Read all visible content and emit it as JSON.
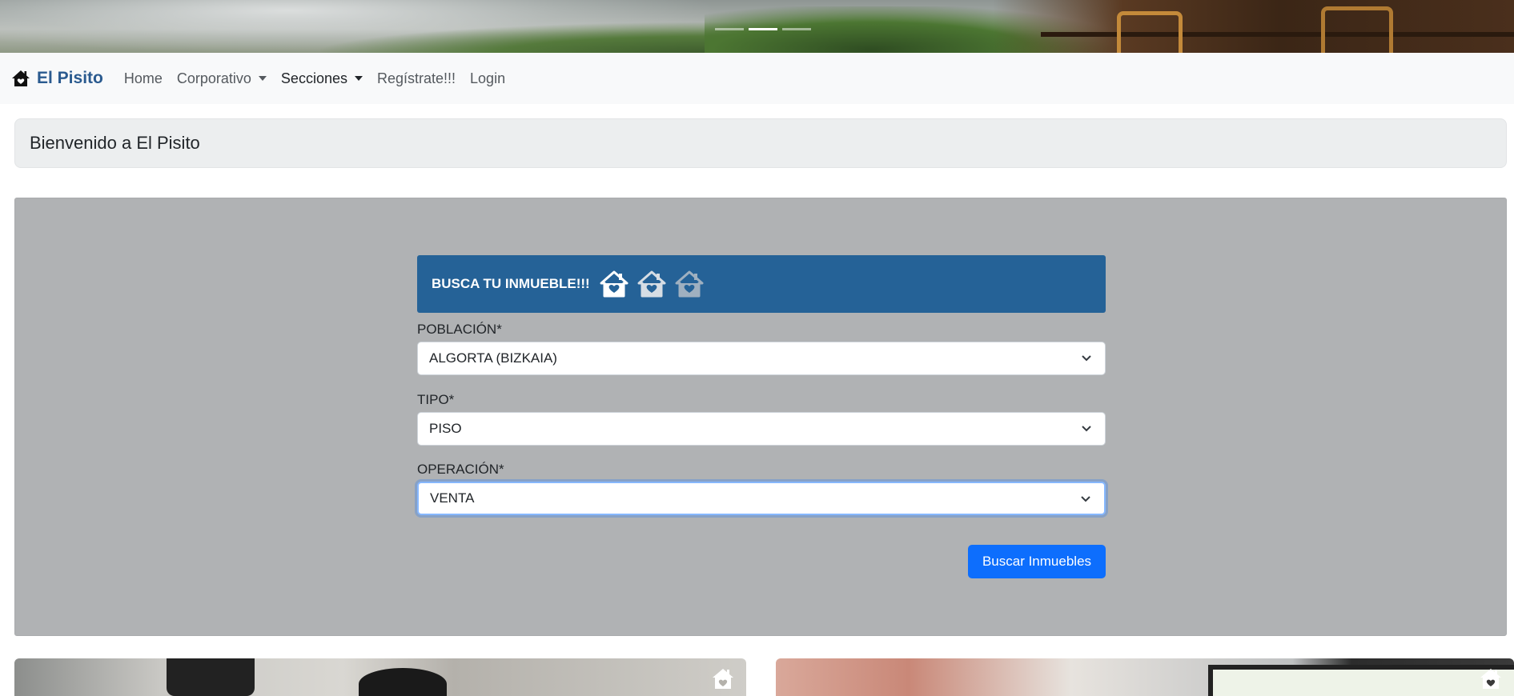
{
  "hero": {
    "slides_count": 3,
    "active_slide": 2
  },
  "navbar": {
    "brand": "El Pisito",
    "items": [
      {
        "label": "Home",
        "dropdown": false
      },
      {
        "label": "Corporativo",
        "dropdown": true
      },
      {
        "label": "Secciones",
        "dropdown": true
      },
      {
        "label": "Regístrate!!!",
        "dropdown": false
      },
      {
        "label": "Login",
        "dropdown": false
      }
    ]
  },
  "welcome": {
    "title": "Bienvenido a El Pisito"
  },
  "search": {
    "header_title": "BUSCA TU INMUEBLE!!!",
    "fields": [
      {
        "label": "POBLACIÓN*",
        "value": "ALGORTA (BIZKAIA)"
      },
      {
        "label": "TIPO*",
        "value": "PISO"
      },
      {
        "label": "OPERACIÓN*",
        "value": "VENTA"
      }
    ],
    "button_label": "Buscar Inmuebles"
  },
  "colors": {
    "brand": "#2a5a8f",
    "panel_header": "#256297",
    "primary_button": "#0d6efd",
    "panel_bg": "#b0b2b4",
    "navbar_bg": "#f8f9fa"
  },
  "icons": {
    "brand": "house-heart-icon",
    "header_houses": [
      "house-heart-icon",
      "house-heart-icon",
      "house-heart-icon"
    ],
    "select_chevron": "chevron-down-icon",
    "card_badge": "house-heart-icon"
  }
}
